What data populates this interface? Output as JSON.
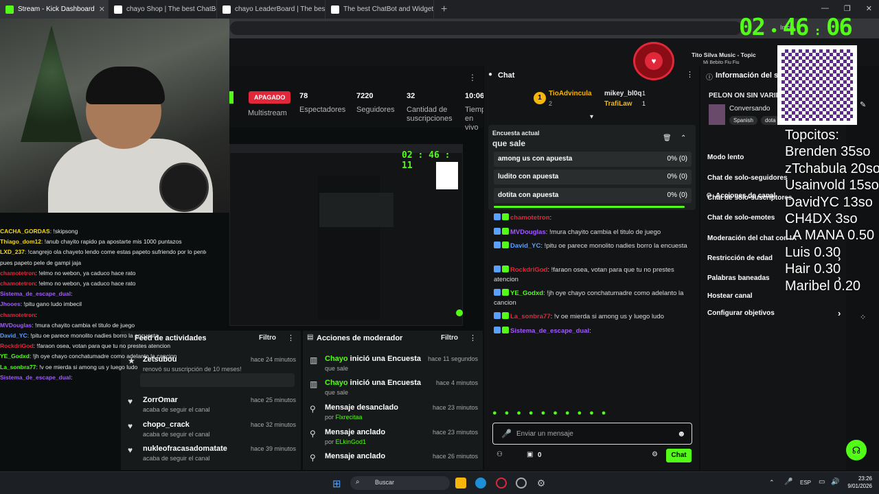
{
  "browser": {
    "tabs": [
      {
        "label": "Stream - Kick Dashboard",
        "active": true
      },
      {
        "label": "chayo Shop | The best ChatBot and",
        "active": false
      },
      {
        "label": "chayo LeaderBoard | The best Cha",
        "active": false
      },
      {
        "label": "The best ChatBot and Widgets for",
        "active": false
      }
    ],
    "address_hint": "Inicia"
  },
  "timer": {
    "hh": "02",
    "mm": "46",
    "ss": "06"
  },
  "music": {
    "artist": "Tito Silva Music - Topic",
    "track": "Mi Bebito Fiu Fiu"
  },
  "stats": {
    "status": "APAGADO",
    "multistream": "Multistream",
    "viewers": {
      "value": "78",
      "label": "Espectadores"
    },
    "followers": {
      "value": "7220",
      "label": "Seguidores"
    },
    "subs": {
      "value": "32",
      "label": "Cantidad de suscripciones"
    },
    "time": {
      "value": "10:06",
      "label": "Tiempo en vivo"
    }
  },
  "overlay_chat": [
    {
      "user": "CACHA_GORDAS",
      "text": ": !skipsong",
      "color": "#f5d90a"
    },
    {
      "user": "Thiago_dom12",
      "text": ": !anub chayito rapido pa apostarte mis 1000 puntazos",
      "color": "#f5d90a"
    },
    {
      "user": "LXD_237",
      "text": ": !cangrejo ola chayeto lendo come estas papeto sufriendo por lo pentes",
      "color": "#f5d90a"
    },
    {
      "user": "",
      "text": "pues papeto pele de gampi jaja",
      "color": "#ffffff"
    },
    {
      "user": "chamotetron",
      "text": ": !elmo no webon, ya caduco hace rato",
      "color": "#e0283a"
    },
    {
      "user": "chamotetron",
      "text": ": !elmo no webon, ya caduco hace rato",
      "color": "#e0283a"
    },
    {
      "user": "Sistema_de_escape_dual",
      "text": ":",
      "color": "#a259ff"
    },
    {
      "user": "Jhooes",
      "text": ": !pitu gano ludo imbecil",
      "color": "#a259ff"
    },
    {
      "user": "chamotetron",
      "text": ":",
      "color": "#e0283a"
    },
    {
      "user": "MVDouglas",
      "text": ": !mura chayito cambia el titulo de juego",
      "color": "#a259ff"
    },
    {
      "user": "David_YC",
      "text": ": !pitu oe parece monolito nadies borro la encuesta",
      "color": "#5aa0ff"
    },
    {
      "user": "RockdriGod",
      "text": ": !faraon osea, votan para que tu no prestes atencion",
      "color": "#e0283a"
    },
    {
      "user": "YE_Godxd",
      "text": ": !jh oye chayo conchatumadre como adelanto la cancion",
      "color": "#53fc18"
    },
    {
      "user": "La_sonbra77",
      "text": ": !v oe mierda si among us y luego ludo",
      "color": "#53fc18"
    },
    {
      "user": "Sistema_de_escape_dual",
      "text": ":",
      "color": "#a259ff"
    }
  ],
  "feed": {
    "title": "Feed de actividades",
    "filter": "Filtro",
    "items": [
      {
        "title": "Zetsubou",
        "sub": "renovó su suscripción de 10 meses!",
        "time": "hace 24 minutos",
        "icon": "star"
      },
      {
        "title": "ZorrOmar",
        "sub": "acaba de seguir el canal",
        "time": "hace 25 minutos",
        "icon": "heart"
      },
      {
        "title": "chopo_crack",
        "sub": "acaba de seguir el canal",
        "time": "hace 32 minutos",
        "icon": "heart"
      },
      {
        "title": "nukleofracasadomatate",
        "sub": "acaba de seguir el canal",
        "time": "hace 39 minutos",
        "icon": "heart"
      }
    ]
  },
  "modfeed": {
    "title": "Acciones de moderador",
    "filter": "Filtro",
    "items": [
      {
        "user": "Chayo",
        "title": " inició una Encuesta",
        "sub": "que sale",
        "time": "hace 11 segundos",
        "icon": "poll"
      },
      {
        "user": "Chayo",
        "title": " inició una Encuesta",
        "sub": "que sale",
        "time": "hace 4 minutos",
        "icon": "poll"
      },
      {
        "user": "",
        "title": "Mensaje desanclado",
        "sub_prefix": "por ",
        "sub": "Flxrecitaa",
        "time": "hace 23 minutos",
        "icon": "pin"
      },
      {
        "user": "",
        "title": "Mensaje anclado",
        "sub_prefix": "por ",
        "sub": "ELkinGod1",
        "time": "hace 23 minutos",
        "icon": "pin"
      },
      {
        "user": "",
        "title": "Mensaje anclado",
        "sub_prefix": "por ",
        "sub": "",
        "time": "hace 26 minutos",
        "icon": "pin"
      }
    ]
  },
  "chat": {
    "title": "Chat",
    "top_gifter": {
      "name": "TioAdvincula",
      "rank": "1",
      "count": "2"
    },
    "gifters": [
      {
        "name": "mikey_bl0q",
        "count": "1"
      },
      {
        "name": "TrafiLaw",
        "count": "1"
      }
    ],
    "poll": {
      "label": "Encuesta actual",
      "question": "que sale",
      "options": [
        {
          "text": "among us con apuesta",
          "pct": "0% (0)"
        },
        {
          "text": "ludito con apuesta",
          "pct": "0% (0)"
        },
        {
          "text": "dotita con apuesta",
          "pct": "0% (0)"
        }
      ]
    },
    "messages": [
      {
        "user": "",
        "text": "por lo pentes pues papeto pele de gampi jaja",
        "color": "#ddd"
      },
      {
        "user": "chamotetron",
        "text": ": !elmo no webon, ya caduco hace rato",
        "color": "#e0283a"
      },
      {
        "user": "chamotetron",
        "text": ": !elmo no webon, ya caduco hace rato",
        "color": "#e0283a"
      },
      {
        "user": "Sistema_de_escape_dual",
        "text": ":",
        "color": "#a259ff"
      },
      {
        "user": "Jhooes",
        "text": ": !pitu gano ludo imbecil",
        "color": "#e0283a"
      },
      {
        "user": "chamotetron",
        "text": ":",
        "color": "#e0283a"
      },
      {
        "user": "MVDouglas",
        "text": ": !mura chayito cambia el titulo de juego",
        "color": "#a259ff"
      },
      {
        "user": "David_YC",
        "text": ": !pitu oe parece monolito nadies borro la encuesta",
        "color": "#5aa0ff"
      },
      {
        "user": "RockdriGod",
        "text": ": !faraon osea, votan para que tu no prestes atencion",
        "color": "#e0283a"
      },
      {
        "user": "YE_Godxd",
        "text": ": !jh oye chayo conchatumadre como adelanto la cancion",
        "color": "#53fc18"
      },
      {
        "user": "La_sonbra77",
        "text": ": !v oe mierda si among us y luego ludo",
        "color": "#e0283a"
      },
      {
        "user": "Sistema_de_escape_dual",
        "text": ":",
        "color": "#a259ff"
      }
    ],
    "input_placeholder": "Enviar un mensaje",
    "points": "0",
    "send_label": "Chat"
  },
  "info": {
    "title": "Información del stream",
    "stream_title": "PELON ON SIN VARIEDAD",
    "category": "Conversando",
    "tags": [
      "Spanish",
      "dota"
    ]
  },
  "actions": {
    "title": "Acciones de canal",
    "items": [
      {
        "label": "Modo lento",
        "chevron": false
      },
      {
        "label": "Chat de solo-seguidores",
        "chevron": false
      },
      {
        "label": "Chat de solo-suscriptores",
        "chevron": false
      },
      {
        "label": "Chat de solo-emotes",
        "chevron": false
      },
      {
        "label": "Moderación del chat con IA",
        "chevron": false
      },
      {
        "label": "Restricción de edad",
        "chevron": true
      },
      {
        "label": "Palabras baneadas",
        "chevron": true
      },
      {
        "label": "Hostear canal",
        "chevron": false
      },
      {
        "label": "Configurar objetivos",
        "chevron": true
      }
    ]
  },
  "topcitos": [
    "Topcitos:",
    "Brenden 35so",
    "zTchabula 20so",
    "Usainvold 15so",
    "DavidYC 13so",
    "CH4DX 3so",
    "LA MANA 0.50",
    "Luis 0.30",
    "Hair 0.30",
    "Maribel 0.20"
  ],
  "taskbar": {
    "search": "Buscar",
    "lang": "ESP",
    "time": "23:26",
    "date": "9/01/2026"
  },
  "colors": {
    "accent": "#53fc18",
    "danger": "#e0283a",
    "bg": "#0b0e0f",
    "panel": "#171a1b"
  }
}
